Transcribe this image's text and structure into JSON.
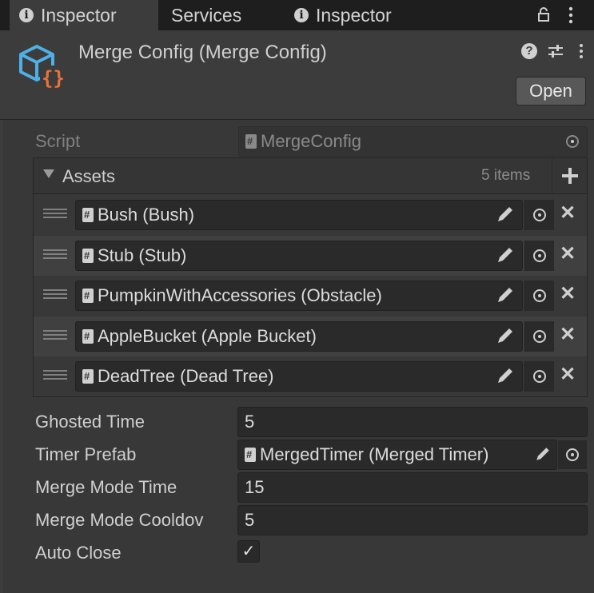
{
  "tabs": [
    {
      "label": "Inspector",
      "icon": "info-icon",
      "active": true
    },
    {
      "label": "Services",
      "active": false
    },
    {
      "label": "Inspector",
      "icon": "info-icon",
      "active": false
    }
  ],
  "header": {
    "title": "Merge Config (Merge Config)",
    "open_label": "Open",
    "icons": [
      "help-icon",
      "preset-icon",
      "kebab-menu-icon"
    ]
  },
  "script": {
    "label": "Script",
    "value": "MergeConfig"
  },
  "assets": {
    "label": "Assets",
    "count": "5 items",
    "items": [
      {
        "value": "Bush (Bush)"
      },
      {
        "value": "Stub (Stub)"
      },
      {
        "value": "PumpkinWithAccessories (Obstacle)"
      },
      {
        "value": "AppleBucket (Apple Bucket)"
      },
      {
        "value": "DeadTree (Dead Tree)"
      }
    ]
  },
  "fields": {
    "ghosted_time": {
      "label": "Ghosted Time",
      "value": "5"
    },
    "timer_prefab": {
      "label": "Timer Prefab",
      "value": "MergedTimer (Merged Timer)"
    },
    "merge_mode_time": {
      "label": "Merge Mode Time",
      "value": "15"
    },
    "merge_mode_cooldown": {
      "label": "Merge Mode Cooldov",
      "value": "5"
    },
    "auto_close": {
      "label": "Auto Close",
      "checked": true,
      "mark": "✓"
    }
  },
  "colors": {
    "panel": "#3c3c3c",
    "field": "#2a2a2a",
    "accent_blue": "#4fb0e6",
    "accent_orange": "#e8733a"
  }
}
